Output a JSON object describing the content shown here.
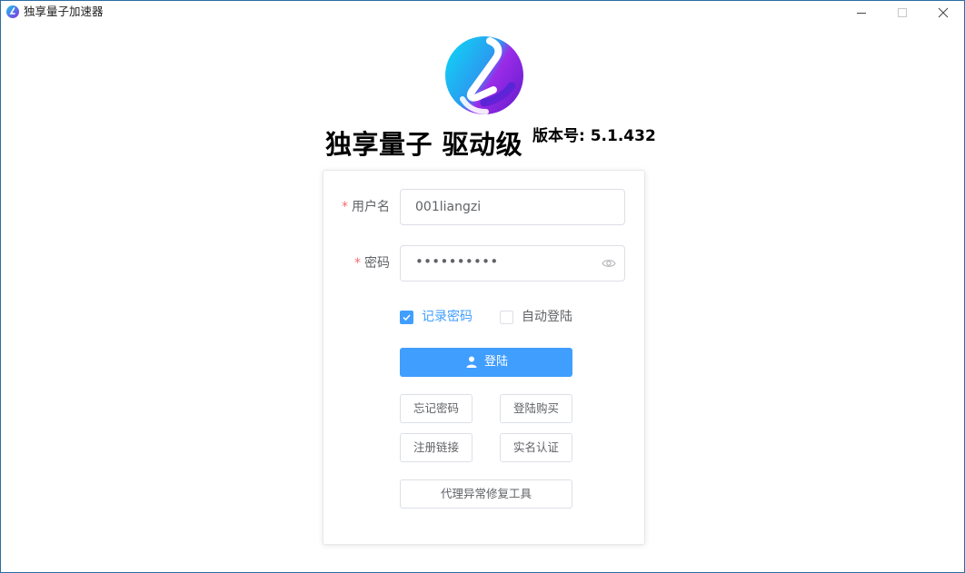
{
  "window": {
    "title": "独享量子加速器"
  },
  "header": {
    "title": "独享量子 驱动级",
    "version": "版本号: 5.1.432"
  },
  "form": {
    "username": {
      "required_mark": "*",
      "label": "用户名",
      "value": "001liangzi"
    },
    "password": {
      "required_mark": "*",
      "label": "密码",
      "value": "••••••••••"
    },
    "remember_password": {
      "label": "记录密码",
      "checked": true
    },
    "auto_login": {
      "label": "自动登陆",
      "checked": false
    },
    "login_button": "登陆"
  },
  "actions": {
    "forgot_password": "忘记密码",
    "login_purchase": "登陆购买",
    "register_link": "注册链接",
    "real_name_auth": "实名认证",
    "proxy_repair_tool": "代理异常修复工具"
  },
  "colors": {
    "accent": "#409eff",
    "required": "#f56c6c",
    "window_border": "#2b6ea3"
  },
  "icons": {
    "app": "app-logo-icon",
    "minimize": "minimize-icon",
    "maximize": "maximize-icon",
    "close": "close-icon",
    "password_toggle": "eye-icon",
    "login": "user-icon"
  }
}
